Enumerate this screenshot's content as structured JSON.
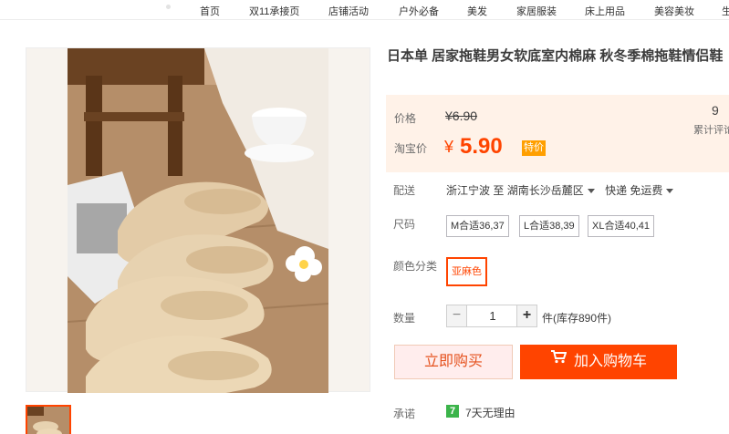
{
  "nav": {
    "items": [
      "首页",
      "双11承接页",
      "店铺活动",
      "户外必备",
      "美发",
      "家居服装",
      "床上用品",
      "美容美妆",
      "生"
    ]
  },
  "product": {
    "title": "日本单 居家拖鞋男女软底室内棉麻 秋冬季棉拖鞋情侣鞋"
  },
  "price": {
    "label": "价格",
    "original": "¥6.90",
    "taobao_label": "淘宝价",
    "currency": "¥",
    "current": "5.90",
    "tag": "特价",
    "sales_count": "9",
    "sales_label": "累计评论"
  },
  "shipping": {
    "label": "配送",
    "from": "浙江宁波",
    "to_word": "至",
    "destination": "湖南长沙岳麓区",
    "method": "快递 免运费"
  },
  "size": {
    "label": "尺码",
    "options": [
      "M合适36,37",
      "L合适38,39",
      "XL合适40,41"
    ]
  },
  "color": {
    "label": "颜色分类",
    "options": [
      "亚麻色"
    ],
    "selected": "亚麻色"
  },
  "quantity": {
    "label": "数量",
    "value": "1",
    "minus": "−",
    "plus": "+",
    "stock": "件(库存890件)"
  },
  "actions": {
    "buy_now": "立即购买",
    "add_to_cart": "加入购物车"
  },
  "promise": {
    "label": "承诺",
    "icon_text": "7",
    "text": "7天无理由"
  },
  "colors": {
    "accent": "#ff4400",
    "price_bg": "#fff2e8",
    "tag_bg": "#ff9f00",
    "promise_green": "#3bb44a"
  }
}
